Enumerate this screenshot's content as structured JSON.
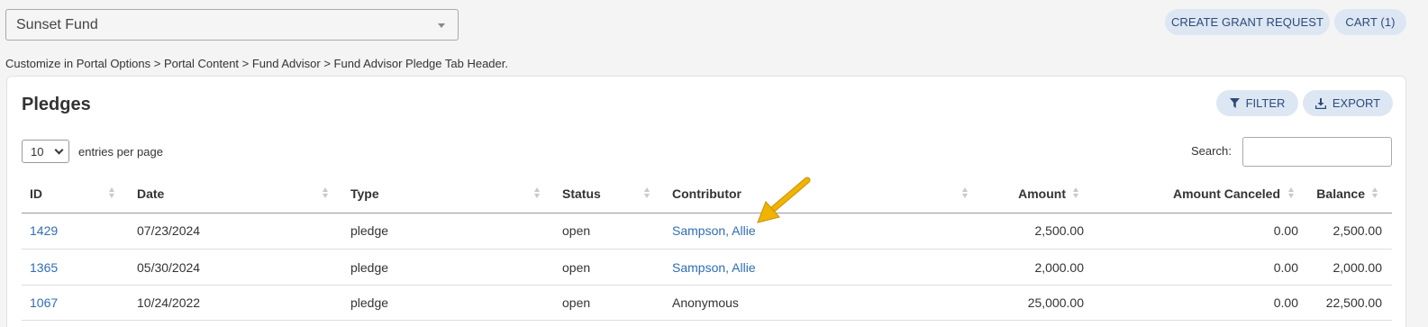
{
  "fund_selector": {
    "value": "Sunset Fund"
  },
  "header_buttons": {
    "create_grant": "CREATE GRANT REQUEST",
    "cart": "CART (1)"
  },
  "customize_hint": "Customize in Portal Options > Portal Content > Fund Advisor > Fund Advisor Pledge Tab Header.",
  "panel": {
    "title": "Pledges",
    "filter_label": "FILTER",
    "export_label": "EXPORT",
    "entries_value": "10",
    "entries_label": "entries per page",
    "search_label": "Search:",
    "search_value": ""
  },
  "table": {
    "columns": [
      "ID",
      "Date",
      "Type",
      "Status",
      "Contributor",
      "Amount",
      "Amount Canceled",
      "Balance"
    ],
    "rows": [
      [
        "1429",
        "07/23/2024",
        "pledge",
        "open",
        "Sampson, Allie",
        "2,500.00",
        "0.00",
        "2,500.00"
      ],
      [
        "1365",
        "05/30/2024",
        "pledge",
        "open",
        "Sampson, Allie",
        "2,000.00",
        "0.00",
        "2,000.00"
      ],
      [
        "1067",
        "10/24/2022",
        "pledge",
        "open",
        "Anonymous",
        "25,000.00",
        "0.00",
        "22,500.00"
      ]
    ],
    "contributor_is_link": [
      true,
      true,
      false
    ]
  },
  "colors": {
    "accent": "#2f6db5",
    "button_bg": "#dde7f3",
    "annotation_arrow": "#f0b400"
  },
  "icons": {
    "fund_caret": "caret-down-icon",
    "filter": "filter-icon",
    "export": "download-icon",
    "sort": "sort-icon",
    "annotation": "arrow-icon"
  }
}
